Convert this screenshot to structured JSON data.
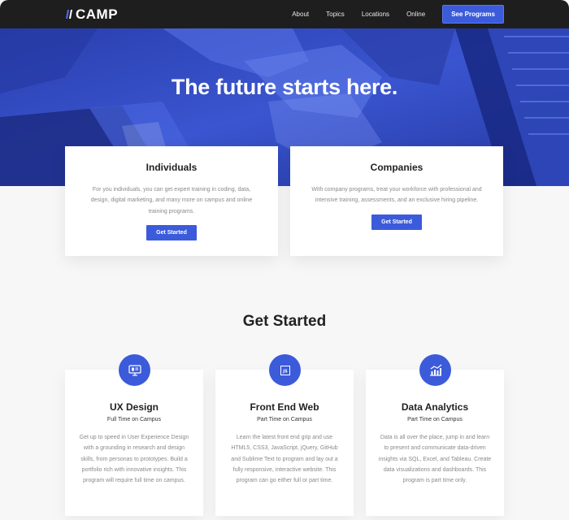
{
  "nav": {
    "logo_text": "CAMP",
    "links": [
      "About",
      "Topics",
      "Locations",
      "Online"
    ],
    "cta": "See Programs"
  },
  "hero": {
    "title": "The future starts here."
  },
  "audiences": [
    {
      "title": "Individuals",
      "text": "For you individuals, you can get expert training in coding, data, design, digital marketing, and many more on campus and online training programs.",
      "button": "Get Started"
    },
    {
      "title": "Companies",
      "text": "With company programs, treat your workforce with professional and intensive training, assessments, and an exclusive hiring pipeline.",
      "button": "Get Started"
    }
  ],
  "programs_section": {
    "title": "Get Started"
  },
  "programs": [
    {
      "icon": "monitor-icon",
      "title": "UX Design",
      "subtitle": "Full Time on Campus",
      "text": "Get up to speed in User Experience Design  with a grounding in research and design skills, from personas to prototypes. Build a portfolio rich with innovative insights. This program will require full time on campus."
    },
    {
      "icon": "js-file-icon",
      "icon_label": "JS",
      "title": "Front End Web",
      "subtitle": "Part Time on Campus",
      "text": "Learn the latest front end grip and use HTML5, CSS3, JavaScript, jQuery, GitHub and Sublime Text to program and lay out a fully responsive, interactive website. This program can go either full or part time."
    },
    {
      "icon": "chart-icon",
      "title": "Data Analytics",
      "subtitle": "Part Time on Campus",
      "text": "Data is all over the place, jump in and learn to present and communicate data-driven insights via SQL, Excel, and Tableau. Create data visualizations and dashboards. This program is part time only."
    }
  ],
  "colors": {
    "accent": "#3b5bdb",
    "nav_bg": "#1e1e1e",
    "hero_bg": "#2f45b8"
  }
}
